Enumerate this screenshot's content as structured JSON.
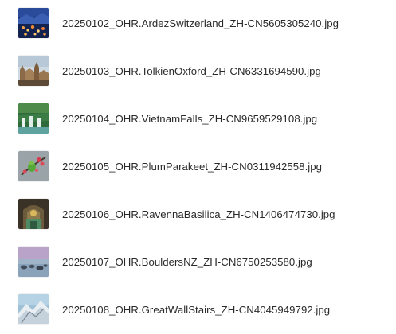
{
  "files": [
    {
      "name": "20250102_OHR.ArdezSwitzerland_ZH-CN5605305240.jpg",
      "thumbnail": "ardez-switzerland-thumbnail"
    },
    {
      "name": "20250103_OHR.TolkienOxford_ZH-CN6331694590.jpg",
      "thumbnail": "tolkien-oxford-thumbnail"
    },
    {
      "name": "20250104_OHR.VietnamFalls_ZH-CN9659529108.jpg",
      "thumbnail": "vietnam-falls-thumbnail"
    },
    {
      "name": "20250105_OHR.PlumParakeet_ZH-CN0311942558.jpg",
      "thumbnail": "plum-parakeet-thumbnail"
    },
    {
      "name": "20250106_OHR.RavennaBasilica_ZH-CN1406474730.jpg",
      "thumbnail": "ravenna-basilica-thumbnail"
    },
    {
      "name": "20250107_OHR.BouldersNZ_ZH-CN6750253580.jpg",
      "thumbnail": "boulders-nz-thumbnail"
    },
    {
      "name": "20250108_OHR.GreatWallStairs_ZH-CN4045949792.jpg",
      "thumbnail": "great-wall-stairs-thumbnail"
    }
  ]
}
